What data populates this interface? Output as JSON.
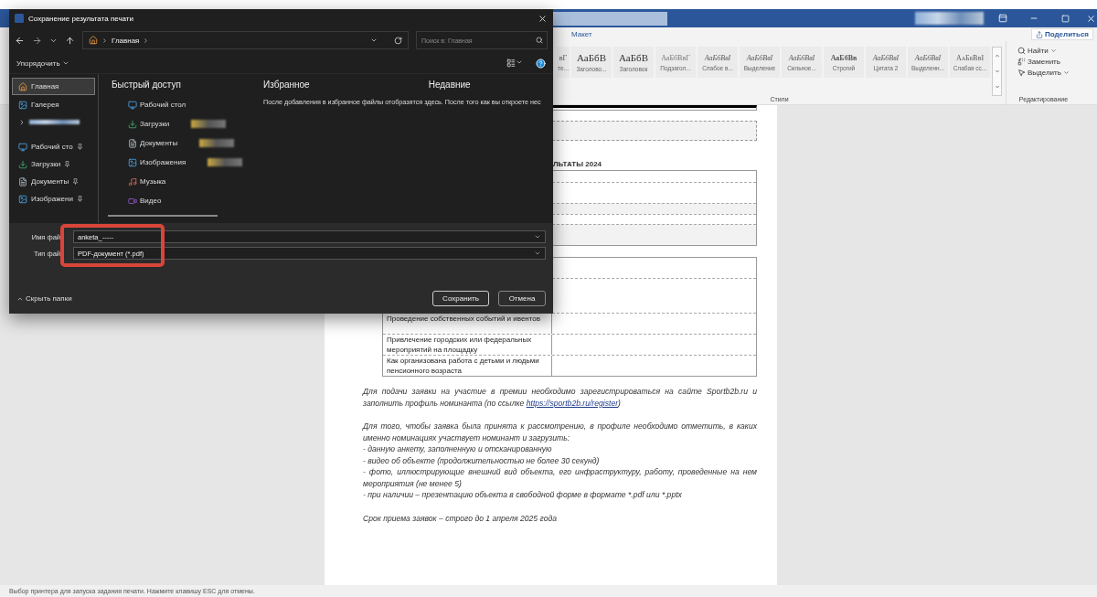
{
  "dialog": {
    "title": "Сохранение результата печати",
    "breadcrumb": [
      "Главная"
    ],
    "search": {
      "placeholder": "Поиск в: Главная"
    },
    "organize": "Упорядочить",
    "sidebar": {
      "items": [
        {
          "kind": "home",
          "label": "Главная",
          "selected": true
        },
        {
          "kind": "gallery",
          "label": "Галерея",
          "selected": false
        },
        {
          "kind": "redacted",
          "selected": false
        },
        {
          "kind": "desktop",
          "label": "Рабочий сто",
          "selected": false,
          "pinned": true
        },
        {
          "kind": "downloads",
          "label": "Загрузки",
          "selected": false,
          "pinned": true
        },
        {
          "kind": "documents",
          "label": "Документы",
          "selected": false,
          "pinned": true
        },
        {
          "kind": "pictures",
          "label": "Изображени",
          "selected": false,
          "pinned": true
        }
      ]
    },
    "quick_access": {
      "title": "Быстрый доступ",
      "items": [
        {
          "kind": "desktop",
          "label": "Рабочий стол"
        },
        {
          "kind": "downloads",
          "label": "Загрузки",
          "redacted_detail": true
        },
        {
          "kind": "documents",
          "label": "Документы",
          "redacted_detail": true
        },
        {
          "kind": "pictures",
          "label": "Изображения",
          "redacted_detail": true
        },
        {
          "kind": "music",
          "label": "Музыка"
        },
        {
          "kind": "video",
          "label": "Видео"
        }
      ]
    },
    "favorites": {
      "title": "Избранное",
      "message": "После добавления в избранное файлы отобразятся здесь. После того как вы откроете нес"
    },
    "recent": {
      "title": "Недавние"
    },
    "fields": [
      {
        "label": "Имя фай",
        "value": "anketa_-----"
      },
      {
        "label": "Тип фай",
        "value": "PDF-документ (*.pdf)"
      }
    ],
    "hide_folders": "Скрыть папки",
    "buttons": [
      {
        "label": "Сохранить",
        "kind": "primary"
      },
      {
        "label": "Отмена",
        "kind": "secondary"
      }
    ]
  },
  "word": {
    "ribbon_tab": "Макет",
    "share": "Поделиться",
    "styles": {
      "label": "Стили",
      "items": [
        {
          "sample": "вГ",
          "name": "те...",
          "kind": "partial"
        },
        {
          "sample": "АаБбВ",
          "name": "Заголово...",
          "kind": "heading"
        },
        {
          "sample": "АаБбВ",
          "name": "Заголовок",
          "kind": "heading"
        },
        {
          "sample": "АаБбВвГ",
          "name": "Подзагол...",
          "kind": "subtle"
        },
        {
          "sample": "АаБбВвI",
          "name": "Слабое в...",
          "kind": "italic"
        },
        {
          "sample": "АаБбВвI",
          "name": "Выделение",
          "kind": "italic"
        },
        {
          "sample": "АаБбВвI",
          "name": "Сильное...",
          "kind": "italic"
        },
        {
          "sample": "АаБбВв",
          "name": "Строгий",
          "kind": "bold"
        },
        {
          "sample": "АаБбВвI",
          "name": "Цитата 2",
          "kind": "italic"
        },
        {
          "sample": "АаБбВвI",
          "name": "Выделенн...",
          "kind": "italic"
        },
        {
          "sample": "АаБбВвI",
          "name": "Слабая сс...",
          "kind": "caps"
        }
      ]
    },
    "editing": {
      "label": "Редактирование",
      "items": [
        {
          "kind": "find",
          "label": "Найти",
          "dropdown": true
        },
        {
          "kind": "replace",
          "label": "Заменить",
          "dropdown": false
        },
        {
          "kind": "select",
          "label": "Выделить",
          "dropdown": true
        }
      ]
    },
    "document": {
      "heading": "ЛЬТАТЫ 2024",
      "table_rows": [
        "Проведение собственных событий и ивентов",
        "Привлечение городских или федеральных мероприятий на площадку",
        "Как организована работа с детьми и людьми пенсионного возраста"
      ],
      "paragraphs": [
        {
          "kind": "para",
          "parts": [
            {
              "text": "Для подачи заявки на участие в премии необходимо зарегистрироваться на сайте Sportb2b.ru и заполнить профиль номинанта (по ссылке "
            },
            {
              "kind": "link",
              "text": "https://sportb2b.ru/register"
            },
            {
              "text": ")"
            }
          ]
        },
        {
          "kind": "para",
          "parts": [
            {
              "text": "Для того, чтобы заявка была принята к рассмотрению, в профиле необходимо отметить, в каких именно номинациях участвует номинант и загрузить:"
            }
          ]
        },
        {
          "kind": "line",
          "parts": [
            {
              "text": "- данную анкету, заполненную и отсканированную"
            }
          ]
        },
        {
          "kind": "line",
          "parts": [
            {
              "text": "- видео об объекте (продолжительностью не более 30 секунд)"
            }
          ]
        },
        {
          "kind": "line",
          "parts": [
            {
              "text": "- фото, иллюстрирующие внешний вид объекта, его инфраструктуру, работу, проведенные на нем мероприятия (не менее 5)"
            }
          ]
        },
        {
          "kind": "line",
          "parts": [
            {
              "text": "- при наличии – презентацию объекта в свободной форме в формате *.pdf или *.pptx"
            }
          ]
        },
        {
          "kind": "para",
          "parts": [
            {
              "text": "Срок приема заявок – строго до 1 апреля 2025 года"
            }
          ]
        }
      ]
    },
    "status": "Выбор принтера для запуска задания печати. Нажмите клавишу ESC для отмены."
  }
}
